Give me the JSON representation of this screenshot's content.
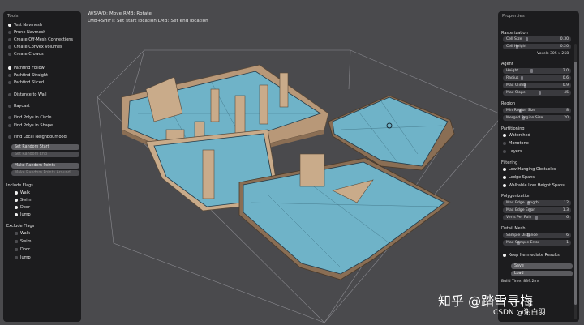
{
  "hints": {
    "line1": "W/S/A/D: Move  RMB: Rotate",
    "line2": "LMB+SHIFT: Set start location  LMB: Set end location"
  },
  "tools": {
    "title": "Tools",
    "items": [
      {
        "label": "Test Navmesh",
        "checked": true
      },
      {
        "label": "Prune Navmesh",
        "checked": false
      },
      {
        "label": "Create Off-Mesh Connections",
        "checked": false
      },
      {
        "label": "Create Convex Volumes",
        "checked": false
      },
      {
        "label": "Create Crowds",
        "checked": false
      }
    ],
    "modes": [
      {
        "label": "Pathfind Follow",
        "checked": true
      },
      {
        "label": "Pathfind Straight",
        "checked": false
      },
      {
        "label": "Pathfind Sliced",
        "checked": false
      },
      {
        "label": "Distance to Wall",
        "checked": false
      },
      {
        "label": "Raycast",
        "checked": false
      },
      {
        "label": "Find Polys in Circle",
        "checked": false
      },
      {
        "label": "Find Polys in Shape",
        "checked": false
      },
      {
        "label": "Find Local Neighbourhood",
        "checked": false
      }
    ],
    "buttons": [
      "Set Random Start",
      "Set Random End",
      "Make Random Points",
      "Make Random Points Around"
    ],
    "include_title": "Include Flags",
    "include_flags": [
      {
        "label": "Walk",
        "checked": true
      },
      {
        "label": "Swim",
        "checked": true
      },
      {
        "label": "Door",
        "checked": true
      },
      {
        "label": "Jump",
        "checked": true
      }
    ],
    "exclude_title": "Exclude Flags",
    "exclude_flags": [
      {
        "label": "Walk",
        "checked": false
      },
      {
        "label": "Swim",
        "checked": false
      },
      {
        "label": "Door",
        "checked": false
      },
      {
        "label": "Jump",
        "checked": false
      }
    ]
  },
  "properties": {
    "title": "Properties",
    "rasterization": "Rasterization",
    "cell_size": {
      "label": "Cell Size",
      "value": "0.30"
    },
    "cell_height": {
      "label": "Cell Height",
      "value": "0.20"
    },
    "voxels": "Voxels  305 x 258",
    "agent": "Agent",
    "height": {
      "label": "Height",
      "value": "2.0"
    },
    "radius": {
      "label": "Radius",
      "value": "0.6"
    },
    "max_climb": {
      "label": "Max Climb",
      "value": "0.9"
    },
    "max_slope": {
      "label": "Max Slope",
      "value": "45"
    },
    "region": "Region",
    "min_region": {
      "label": "Min Region Size",
      "value": "8"
    },
    "merged_region": {
      "label": "Merged Region Size",
      "value": "20"
    },
    "partitioning": "Partitioning",
    "part_options": [
      {
        "label": "Watershed",
        "checked": true
      },
      {
        "label": "Monotone",
        "checked": false
      },
      {
        "label": "Layers",
        "checked": false
      }
    ],
    "filtering": "Filtering",
    "filter_options": [
      {
        "label": "Low Hanging Obstacles",
        "checked": true
      },
      {
        "label": "Ledge Spans",
        "checked": true
      },
      {
        "label": "Walkable Low Height Spans",
        "checked": true
      }
    ],
    "polygonization": "Polygonization",
    "max_edge_len": {
      "label": "Max Edge Length",
      "value": "12"
    },
    "max_edge_err": {
      "label": "Max Edge Error",
      "value": "1.3"
    },
    "verts_per_poly": {
      "label": "Verts Per Poly",
      "value": "6"
    },
    "detail_mesh": "Detail Mesh",
    "sample_dist": {
      "label": "Sample Distance",
      "value": "6"
    },
    "max_sample_err": {
      "label": "Max Sample Error",
      "value": "1"
    },
    "keep_intermediate": "Keep Itermediate Results",
    "save": "Save",
    "load": "Load",
    "build_time": "Build Time: 839.2ms"
  },
  "watermark": {
    "main": "知乎 @踏雪寻梅",
    "sub": "CSDN @谢白羽"
  },
  "colors": {
    "navmesh": "#6fb3c8",
    "walls": "#c9ab8a",
    "panel": "#18181a",
    "bg": "#4a4a4d"
  }
}
